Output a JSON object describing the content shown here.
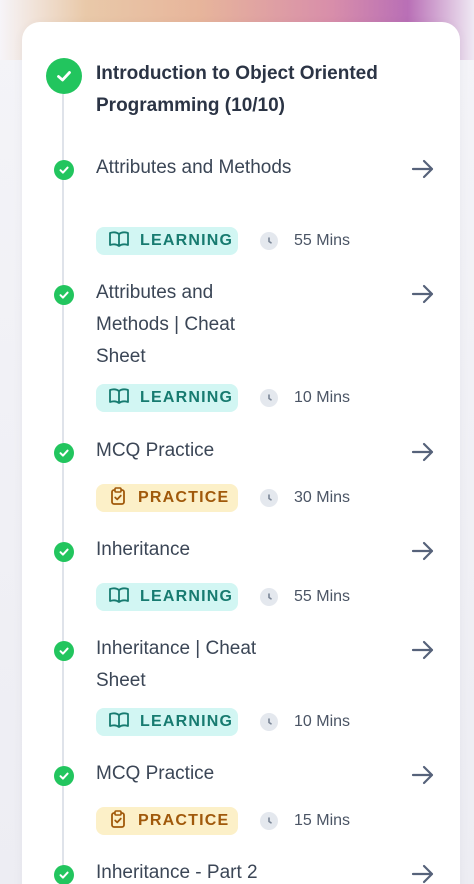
{
  "module": {
    "title": "Introduction to Object Oriented Programming (10/10)"
  },
  "items": [
    {
      "title": "Attributes and Methods",
      "badge": "LEARNING",
      "duration": "55 Mins"
    },
    {
      "title": "Attributes and Methods | Cheat Sheet",
      "badge": "LEARNING",
      "duration": "10 Mins"
    },
    {
      "title": "MCQ Practice",
      "badge": "PRACTICE",
      "duration": "30 Mins"
    },
    {
      "title": "Inheritance",
      "badge": "LEARNING",
      "duration": "55 Mins"
    },
    {
      "title": "Inheritance | Cheat Sheet",
      "badge": "LEARNING",
      "duration": "10 Mins"
    },
    {
      "title": "MCQ Practice",
      "badge": "PRACTICE",
      "duration": "15 Mins"
    },
    {
      "title": "Inheritance - Part 2"
    }
  ],
  "colors": {
    "complete_green": "#22c55e",
    "learning_bg": "#d2f6f3",
    "learning_text": "#177b70",
    "practice_bg": "#fcf0c8",
    "practice_text": "#a0590b"
  },
  "icons": {
    "status": "check-circle-icon",
    "navigate": "arrow-right-icon",
    "learning": "book-open-icon",
    "practice": "clipboard-check-icon",
    "duration": "clock-icon"
  }
}
